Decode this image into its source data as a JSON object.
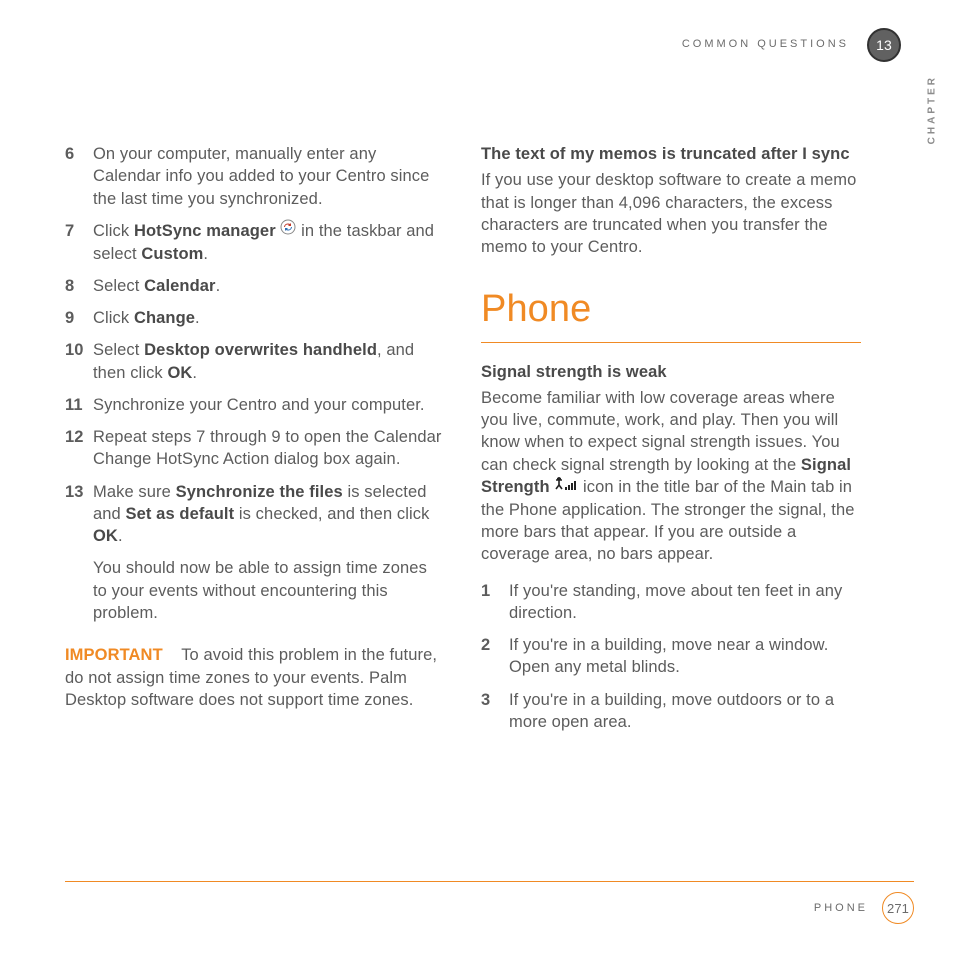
{
  "header": {
    "running_head": "COMMON QUESTIONS",
    "chapter_number": "13",
    "chapter_label": "CHAPTER"
  },
  "left": {
    "steps": [
      {
        "num": "6",
        "prefix": "",
        "bold1": "",
        "mid": "On your computer, manually enter any Calendar info you added to your Centro since the last time you synchronized.",
        "bold2": "",
        "suffix": ""
      },
      {
        "num": "7",
        "prefix": "Click ",
        "bold1": "HotSync manager",
        "mid": " ",
        "icon": "hotsync",
        "mid2": " in the taskbar and select ",
        "bold2": "Custom",
        "suffix": "."
      },
      {
        "num": "8",
        "prefix": "Select ",
        "bold1": "Calendar",
        "mid": ".",
        "bold2": "",
        "suffix": ""
      },
      {
        "num": "9",
        "prefix": "Click ",
        "bold1": "Change",
        "mid": ".",
        "bold2": "",
        "suffix": ""
      },
      {
        "num": "10",
        "prefix": "Select ",
        "bold1": "Desktop overwrites handheld",
        "mid": ", and then click ",
        "bold2": "OK",
        "suffix": "."
      },
      {
        "num": "11",
        "prefix": "",
        "bold1": "",
        "mid": "Synchronize your Centro and your computer.",
        "bold2": "",
        "suffix": ""
      },
      {
        "num": "12",
        "prefix": "",
        "bold1": "",
        "mid": "Repeat steps 7 through 9 to open the Calendar Change HotSync Action dialog box again.",
        "bold2": "",
        "suffix": ""
      },
      {
        "num": "13",
        "prefix": "Make sure ",
        "bold1": "Synchronize the files",
        "mid": " is selected and ",
        "bold2": "Set as default",
        "mid3": " is checked, and then click ",
        "bold3": "OK",
        "suffix": "."
      }
    ],
    "after13": "You should now be able to assign time zones to your events without encountering this problem.",
    "important_label": "IMPORTANT",
    "important_text": "To avoid this problem in the future, do not assign time zones to your events. Palm Desktop software does not support time zones."
  },
  "right": {
    "sub1_head": "The text of my memos is truncated after I sync",
    "sub1_body": "If you use your desktop software to create a memo that is longer than 4,096 characters, the excess characters are truncated when you transfer the memo to your Centro.",
    "section_title": "Phone",
    "sub2_head": "Signal strength is weak",
    "sub2_body_a": "Become familiar with low coverage areas where you live, commute, work, and play. Then you will know when to expect signal strength issues. You can check signal strength by looking at the ",
    "sub2_bold": "Signal Strength",
    "sub2_body_b": " icon in the title bar of the Main tab in the Phone application. The stronger the signal, the more bars that appear. If you are outside a coverage area, no bars appear.",
    "steps": [
      {
        "num": "1",
        "text": "If you're standing, move about ten feet in any direction."
      },
      {
        "num": "2",
        "text": "If you're in a building, move near a window. Open any metal blinds."
      },
      {
        "num": "3",
        "text": "If you're in a building, move outdoors or to a more open area."
      }
    ]
  },
  "footer": {
    "label": "PHONE",
    "page": "271"
  }
}
